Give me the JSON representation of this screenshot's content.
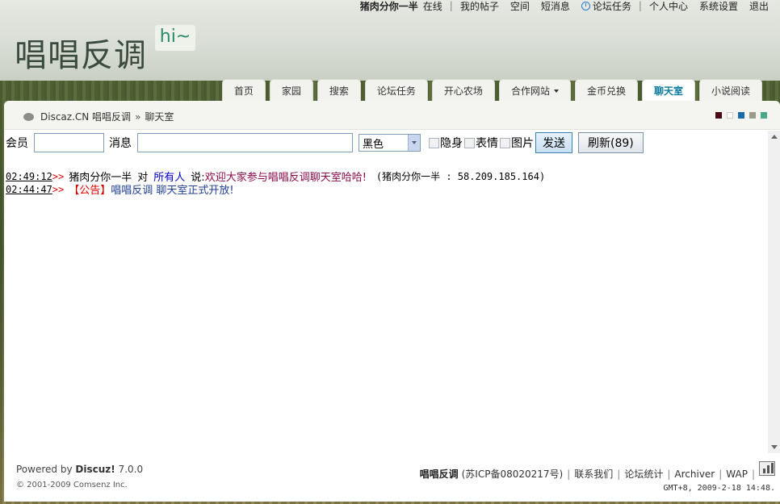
{
  "topbar": {
    "username": "猪肉分你一半",
    "online": "在线",
    "my_posts": "我的帖子",
    "space": "空间",
    "messages": "短消息",
    "tasks": "论坛任务",
    "user_center": "个人中心",
    "settings": "系统设置",
    "logout": "退出"
  },
  "logo": {
    "text": "唱唱反调",
    "badge": "hi~"
  },
  "nav": [
    "首页",
    "家园",
    "搜索",
    "论坛任务",
    "开心农场",
    "合作网站",
    "金币兑换",
    "聊天室",
    "小说阅读"
  ],
  "breadcrumb": {
    "site": "Discaz.CN 唱唱反调",
    "sep": "»",
    "page": "聊天室"
  },
  "swatches": [
    "#4a0a14",
    "#ffffff",
    "#1a6aa6",
    "#9b9b8c",
    "#4aa88a"
  ],
  "form": {
    "member_label": "会员",
    "member_value": "",
    "message_label": "消息",
    "message_value": "",
    "color_selected": "黑色",
    "hidden_label": "隐身",
    "emoji_label": "表情",
    "image_label": "图片",
    "send_label": "发送",
    "refresh_label": "刷新(89)"
  },
  "messages": [
    {
      "time": "02:49:12",
      "arrow": ">>",
      "from": "猪肉分你一半",
      "to_word": "对",
      "to": "所有人",
      "say": "说:",
      "content": "欢迎大家参与唱唱反调聊天室哈哈!",
      "ip": "(猪肉分你一半 : 58.209.185.164)"
    },
    {
      "time": "02:44:47",
      "arrow": ">>",
      "notice": "【公告】",
      "content": "唱唱反调 聊天室正式开放!"
    }
  ],
  "footer": {
    "powered": "Powered by",
    "product": "Discuz!",
    "version": "7.0.0",
    "copyright": "© 2001-2009 Comsenz Inc.",
    "site": "唱唱反调",
    "icp": "(苏ICP备08020217号)",
    "contact": "联系我们",
    "stats": "论坛统计",
    "archiver": "Archiver",
    "wap": "WAP",
    "gmt": "GMT+8, 2009-2-18 14:48."
  }
}
